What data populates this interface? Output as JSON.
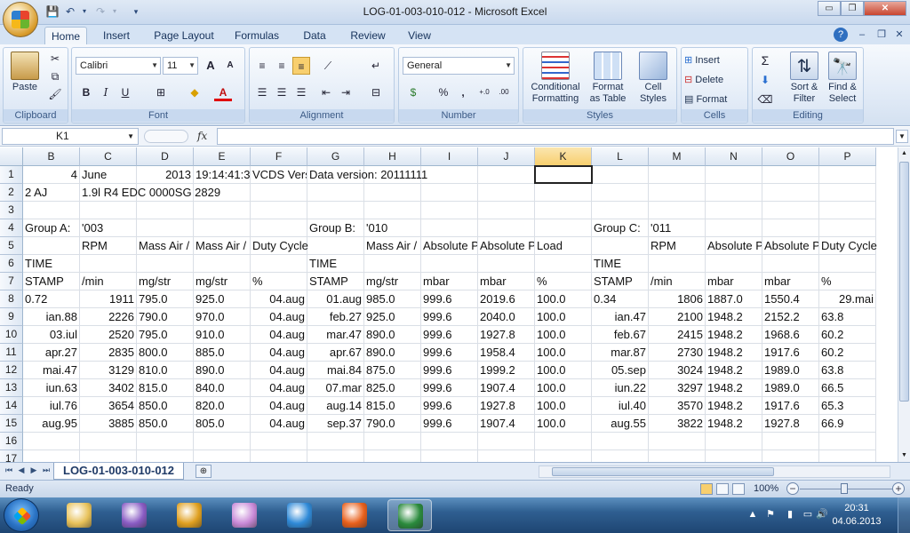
{
  "window": {
    "title": "LOG-01-003-010-012 - Microsoft Excel",
    "minimize": "▭",
    "restore": "❐",
    "close": "✕"
  },
  "ribbon_tabs": [
    "Home",
    "Insert",
    "Page Layout",
    "Formulas",
    "Data",
    "Review",
    "View"
  ],
  "ribbon": {
    "clipboard": {
      "paste": "Paste",
      "label": "Clipboard"
    },
    "font": {
      "name": "Calibri",
      "size": "11",
      "label": "Font",
      "bold": "B",
      "italic": "I",
      "underline": "U",
      "grow": "A",
      "shrink": "A"
    },
    "alignment": {
      "label": "Alignment"
    },
    "number": {
      "format": "General",
      "label": "Number",
      "percent": "%",
      "comma": ",",
      "inc": "+.0",
      "dec": ".00"
    },
    "styles": {
      "conditional": [
        "Conditional",
        "Formatting"
      ],
      "as_table": [
        "Format",
        "as Table"
      ],
      "cell_styles": [
        "Cell",
        "Styles"
      ],
      "label": "Styles"
    },
    "cells": {
      "insert": "Insert",
      "delete": "Delete",
      "format": "Format",
      "label": "Cells"
    },
    "editing": {
      "sum": "Σ",
      "sort": [
        "Sort &",
        "Filter"
      ],
      "find": [
        "Find &",
        "Select"
      ],
      "label": "Editing"
    }
  },
  "formula_bar": {
    "namebox": "K1",
    "fx": "fx",
    "value": ""
  },
  "columns": [
    "B",
    "C",
    "D",
    "E",
    "F",
    "G",
    "H",
    "I",
    "J",
    "K",
    "L",
    "M",
    "N",
    "O",
    "P"
  ],
  "selected_column": "K",
  "rows": [
    {
      "n": "1",
      "cells": [
        {
          "col": "B",
          "v": "4",
          "a": "r"
        },
        {
          "col": "C",
          "v": "June"
        },
        {
          "col": "D",
          "v": "2013",
          "a": "r"
        },
        {
          "col": "E",
          "v": "19:14:41:3",
          "clip": true
        },
        {
          "col": "F",
          "v": "VCDS Vers",
          "clip": true
        },
        {
          "col": "G",
          "v": "Data version: 20111111"
        }
      ]
    },
    {
      "n": "2",
      "cells": [
        {
          "col": "B",
          "v": "2 AJ"
        },
        {
          "col": "C",
          "v": "1.9l R4 EDC 0000SG  2829"
        }
      ]
    },
    {
      "n": "3",
      "cells": []
    },
    {
      "n": "4",
      "cells": [
        {
          "col": "B",
          "v": "Group A:"
        },
        {
          "col": "C",
          "v": "'003"
        },
        {
          "col": "G",
          "v": "Group B:"
        },
        {
          "col": "H",
          "v": "'010"
        },
        {
          "col": "L",
          "v": "Group C:"
        },
        {
          "col": "M",
          "v": "'011"
        }
      ]
    },
    {
      "n": "5",
      "cells": [
        {
          "col": "C",
          "v": "RPM"
        },
        {
          "col": "D",
          "v": "Mass Air /",
          "clip": true
        },
        {
          "col": "E",
          "v": "Mass Air /",
          "clip": true
        },
        {
          "col": "F",
          "v": "Duty Cycle"
        },
        {
          "col": "H",
          "v": "Mass Air /",
          "clip": true
        },
        {
          "col": "I",
          "v": "Absolute P",
          "clip": true
        },
        {
          "col": "J",
          "v": "Absolute P",
          "clip": true
        },
        {
          "col": "K",
          "v": "Load"
        },
        {
          "col": "M",
          "v": "RPM"
        },
        {
          "col": "N",
          "v": "Absolute P",
          "clip": true
        },
        {
          "col": "O",
          "v": "Absolute P",
          "clip": true
        },
        {
          "col": "P",
          "v": "Duty Cycle"
        }
      ]
    },
    {
      "n": "6",
      "cells": [
        {
          "col": "B",
          "v": "TIME"
        },
        {
          "col": "G",
          "v": "TIME"
        },
        {
          "col": "L",
          "v": "TIME"
        }
      ]
    },
    {
      "n": "7",
      "cells": [
        {
          "col": "B",
          "v": "STAMP"
        },
        {
          "col": "C",
          "v": "/min"
        },
        {
          "col": "D",
          "v": "mg/str"
        },
        {
          "col": "E",
          "v": "mg/str"
        },
        {
          "col": "F",
          "v": "%"
        },
        {
          "col": "G",
          "v": "STAMP"
        },
        {
          "col": "H",
          "v": "mg/str"
        },
        {
          "col": "I",
          "v": "mbar"
        },
        {
          "col": "J",
          "v": "mbar"
        },
        {
          "col": "K",
          "v": "%"
        },
        {
          "col": "L",
          "v": "STAMP"
        },
        {
          "col": "M",
          "v": "/min"
        },
        {
          "col": "N",
          "v": "mbar"
        },
        {
          "col": "O",
          "v": "mbar"
        },
        {
          "col": "P",
          "v": "%"
        }
      ]
    },
    {
      "n": "8",
      "cells": [
        {
          "col": "B",
          "v": "0.72"
        },
        {
          "col": "C",
          "v": "1911",
          "a": "r"
        },
        {
          "col": "D",
          "v": "795.0"
        },
        {
          "col": "E",
          "v": "925.0"
        },
        {
          "col": "F",
          "v": "04.aug",
          "a": "r"
        },
        {
          "col": "G",
          "v": "01.aug",
          "a": "r"
        },
        {
          "col": "H",
          "v": "985.0"
        },
        {
          "col": "I",
          "v": "999.6"
        },
        {
          "col": "J",
          "v": "2019.6"
        },
        {
          "col": "K",
          "v": "100.0"
        },
        {
          "col": "L",
          "v": "0.34"
        },
        {
          "col": "M",
          "v": "1806",
          "a": "r"
        },
        {
          "col": "N",
          "v": "1887.0"
        },
        {
          "col": "O",
          "v": "1550.4"
        },
        {
          "col": "P",
          "v": "29.mai",
          "a": "r"
        }
      ]
    },
    {
      "n": "9",
      "cells": [
        {
          "col": "B",
          "v": "ian.88",
          "a": "r"
        },
        {
          "col": "C",
          "v": "2226",
          "a": "r"
        },
        {
          "col": "D",
          "v": "790.0"
        },
        {
          "col": "E",
          "v": "970.0"
        },
        {
          "col": "F",
          "v": "04.aug",
          "a": "r"
        },
        {
          "col": "G",
          "v": "feb.27",
          "a": "r"
        },
        {
          "col": "H",
          "v": "925.0"
        },
        {
          "col": "I",
          "v": "999.6"
        },
        {
          "col": "J",
          "v": "2040.0"
        },
        {
          "col": "K",
          "v": "100.0"
        },
        {
          "col": "L",
          "v": "ian.47",
          "a": "r"
        },
        {
          "col": "M",
          "v": "2100",
          "a": "r"
        },
        {
          "col": "N",
          "v": "1948.2"
        },
        {
          "col": "O",
          "v": "2152.2"
        },
        {
          "col": "P",
          "v": "63.8"
        }
      ]
    },
    {
      "n": "10",
      "cells": [
        {
          "col": "B",
          "v": "03.iul",
          "a": "r"
        },
        {
          "col": "C",
          "v": "2520",
          "a": "r"
        },
        {
          "col": "D",
          "v": "795.0"
        },
        {
          "col": "E",
          "v": "910.0"
        },
        {
          "col": "F",
          "v": "04.aug",
          "a": "r"
        },
        {
          "col": "G",
          "v": "mar.47",
          "a": "r"
        },
        {
          "col": "H",
          "v": "890.0"
        },
        {
          "col": "I",
          "v": "999.6"
        },
        {
          "col": "J",
          "v": "1927.8"
        },
        {
          "col": "K",
          "v": "100.0"
        },
        {
          "col": "L",
          "v": "feb.67",
          "a": "r"
        },
        {
          "col": "M",
          "v": "2415",
          "a": "r"
        },
        {
          "col": "N",
          "v": "1948.2"
        },
        {
          "col": "O",
          "v": "1968.6"
        },
        {
          "col": "P",
          "v": "60.2"
        }
      ]
    },
    {
      "n": "11",
      "cells": [
        {
          "col": "B",
          "v": "apr.27",
          "a": "r"
        },
        {
          "col": "C",
          "v": "2835",
          "a": "r"
        },
        {
          "col": "D",
          "v": "800.0"
        },
        {
          "col": "E",
          "v": "885.0"
        },
        {
          "col": "F",
          "v": "04.aug",
          "a": "r"
        },
        {
          "col": "G",
          "v": "apr.67",
          "a": "r"
        },
        {
          "col": "H",
          "v": "890.0"
        },
        {
          "col": "I",
          "v": "999.6"
        },
        {
          "col": "J",
          "v": "1958.4"
        },
        {
          "col": "K",
          "v": "100.0"
        },
        {
          "col": "L",
          "v": "mar.87",
          "a": "r"
        },
        {
          "col": "M",
          "v": "2730",
          "a": "r"
        },
        {
          "col": "N",
          "v": "1948.2"
        },
        {
          "col": "O",
          "v": "1917.6"
        },
        {
          "col": "P",
          "v": "60.2"
        }
      ]
    },
    {
      "n": "12",
      "cells": [
        {
          "col": "B",
          "v": "mai.47",
          "a": "r"
        },
        {
          "col": "C",
          "v": "3129",
          "a": "r"
        },
        {
          "col": "D",
          "v": "810.0"
        },
        {
          "col": "E",
          "v": "890.0"
        },
        {
          "col": "F",
          "v": "04.aug",
          "a": "r"
        },
        {
          "col": "G",
          "v": "mai.84",
          "a": "r"
        },
        {
          "col": "H",
          "v": "875.0"
        },
        {
          "col": "I",
          "v": "999.6"
        },
        {
          "col": "J",
          "v": "1999.2"
        },
        {
          "col": "K",
          "v": "100.0"
        },
        {
          "col": "L",
          "v": "05.sep",
          "a": "r"
        },
        {
          "col": "M",
          "v": "3024",
          "a": "r"
        },
        {
          "col": "N",
          "v": "1948.2"
        },
        {
          "col": "O",
          "v": "1989.0"
        },
        {
          "col": "P",
          "v": "63.8"
        }
      ]
    },
    {
      "n": "13",
      "cells": [
        {
          "col": "B",
          "v": "iun.63",
          "a": "r"
        },
        {
          "col": "C",
          "v": "3402",
          "a": "r"
        },
        {
          "col": "D",
          "v": "815.0"
        },
        {
          "col": "E",
          "v": "840.0"
        },
        {
          "col": "F",
          "v": "04.aug",
          "a": "r"
        },
        {
          "col": "G",
          "v": "07.mar",
          "a": "r"
        },
        {
          "col": "H",
          "v": "825.0"
        },
        {
          "col": "I",
          "v": "999.6"
        },
        {
          "col": "J",
          "v": "1907.4"
        },
        {
          "col": "K",
          "v": "100.0"
        },
        {
          "col": "L",
          "v": "iun.22",
          "a": "r"
        },
        {
          "col": "M",
          "v": "3297",
          "a": "r"
        },
        {
          "col": "N",
          "v": "1948.2"
        },
        {
          "col": "O",
          "v": "1989.0"
        },
        {
          "col": "P",
          "v": "66.5"
        }
      ]
    },
    {
      "n": "14",
      "cells": [
        {
          "col": "B",
          "v": "iul.76",
          "a": "r"
        },
        {
          "col": "C",
          "v": "3654",
          "a": "r"
        },
        {
          "col": "D",
          "v": "850.0"
        },
        {
          "col": "E",
          "v": "820.0"
        },
        {
          "col": "F",
          "v": "04.aug",
          "a": "r"
        },
        {
          "col": "G",
          "v": "aug.14",
          "a": "r"
        },
        {
          "col": "H",
          "v": "815.0"
        },
        {
          "col": "I",
          "v": "999.6"
        },
        {
          "col": "J",
          "v": "1927.8"
        },
        {
          "col": "K",
          "v": "100.0"
        },
        {
          "col": "L",
          "v": "iul.40",
          "a": "r"
        },
        {
          "col": "M",
          "v": "3570",
          "a": "r"
        },
        {
          "col": "N",
          "v": "1948.2"
        },
        {
          "col": "O",
          "v": "1917.6"
        },
        {
          "col": "P",
          "v": "65.3"
        }
      ]
    },
    {
      "n": "15",
      "cells": [
        {
          "col": "B",
          "v": "aug.95",
          "a": "r"
        },
        {
          "col": "C",
          "v": "3885",
          "a": "r"
        },
        {
          "col": "D",
          "v": "850.0"
        },
        {
          "col": "E",
          "v": "805.0"
        },
        {
          "col": "F",
          "v": "04.aug",
          "a": "r"
        },
        {
          "col": "G",
          "v": "sep.37",
          "a": "r"
        },
        {
          "col": "H",
          "v": "790.0"
        },
        {
          "col": "I",
          "v": "999.6"
        },
        {
          "col": "J",
          "v": "1907.4"
        },
        {
          "col": "K",
          "v": "100.0"
        },
        {
          "col": "L",
          "v": "aug.55",
          "a": "r"
        },
        {
          "col": "M",
          "v": "3822",
          "a": "r"
        },
        {
          "col": "N",
          "v": "1948.2"
        },
        {
          "col": "O",
          "v": "1927.8"
        },
        {
          "col": "P",
          "v": "66.9"
        }
      ]
    },
    {
      "n": "16",
      "cells": []
    },
    {
      "n": "17",
      "cells": []
    }
  ],
  "sheet_tab": "LOG-01-003-010-012",
  "status": {
    "ready": "Ready",
    "zoom": "100%",
    "minus": "−",
    "plus": "+"
  },
  "clock": {
    "time": "20:31",
    "date": "04.06.2013"
  },
  "taskbar_apps": [
    {
      "name": "explorer",
      "color": "#e8c25a"
    },
    {
      "name": "visual-studio",
      "color": "#8a5cc4"
    },
    {
      "name": "winamp",
      "color": "#e0a020"
    },
    {
      "name": "messenger",
      "color": "#c98ad8"
    },
    {
      "name": "internet-explorer",
      "color": "#2f8ad8"
    },
    {
      "name": "firefox",
      "color": "#e8601c"
    },
    {
      "name": "excel",
      "color": "#2a8a3c"
    }
  ]
}
